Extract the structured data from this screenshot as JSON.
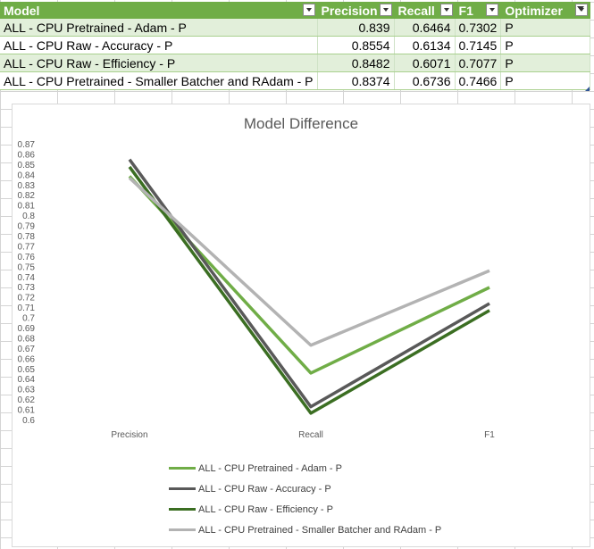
{
  "table": {
    "headers": [
      "Model",
      "Precision",
      "Recall",
      "F1",
      "Optimizer"
    ],
    "rows": [
      [
        "ALL - CPU Pretrained - Adam - P",
        "0.839",
        "0.6464",
        "0.7302",
        "P"
      ],
      [
        "ALL - CPU Raw - Accuracy - P",
        "0.8554",
        "0.6134",
        "0.7145",
        "P"
      ],
      [
        "ALL - CPU Raw - Efficiency - P",
        "0.8482",
        "0.6071",
        "0.7077",
        "P"
      ],
      [
        "ALL - CPU Pretrained - Smaller Batcher and RAdam - P",
        "0.8374",
        "0.6736",
        "0.7466",
        "P"
      ]
    ]
  },
  "colors": {
    "header_bg": "#70ad47",
    "band_bg": "#e2efda"
  },
  "chart_data": {
    "type": "line",
    "title": "Model Difference",
    "categories": [
      "Precision",
      "Recall",
      "F1"
    ],
    "ylim": [
      0.6,
      0.87
    ],
    "ytick_step": 0.01,
    "grid": false,
    "legend_position": "bottom",
    "series": [
      {
        "name": "ALL - CPU Pretrained - Adam - P",
        "values": [
          0.839,
          0.6464,
          0.7302
        ],
        "color": "#70ad47"
      },
      {
        "name": "ALL - CPU Raw - Accuracy - P",
        "values": [
          0.8554,
          0.6134,
          0.7145
        ],
        "color": "#595959"
      },
      {
        "name": "ALL - CPU Raw - Efficiency - P",
        "values": [
          0.8482,
          0.6071,
          0.7077
        ],
        "color": "#3b6e22"
      },
      {
        "name": "ALL - CPU Pretrained - Smaller Batcher and RAdam - P",
        "values": [
          0.8374,
          0.6736,
          0.7466
        ],
        "color": "#b3b3b3"
      }
    ]
  }
}
